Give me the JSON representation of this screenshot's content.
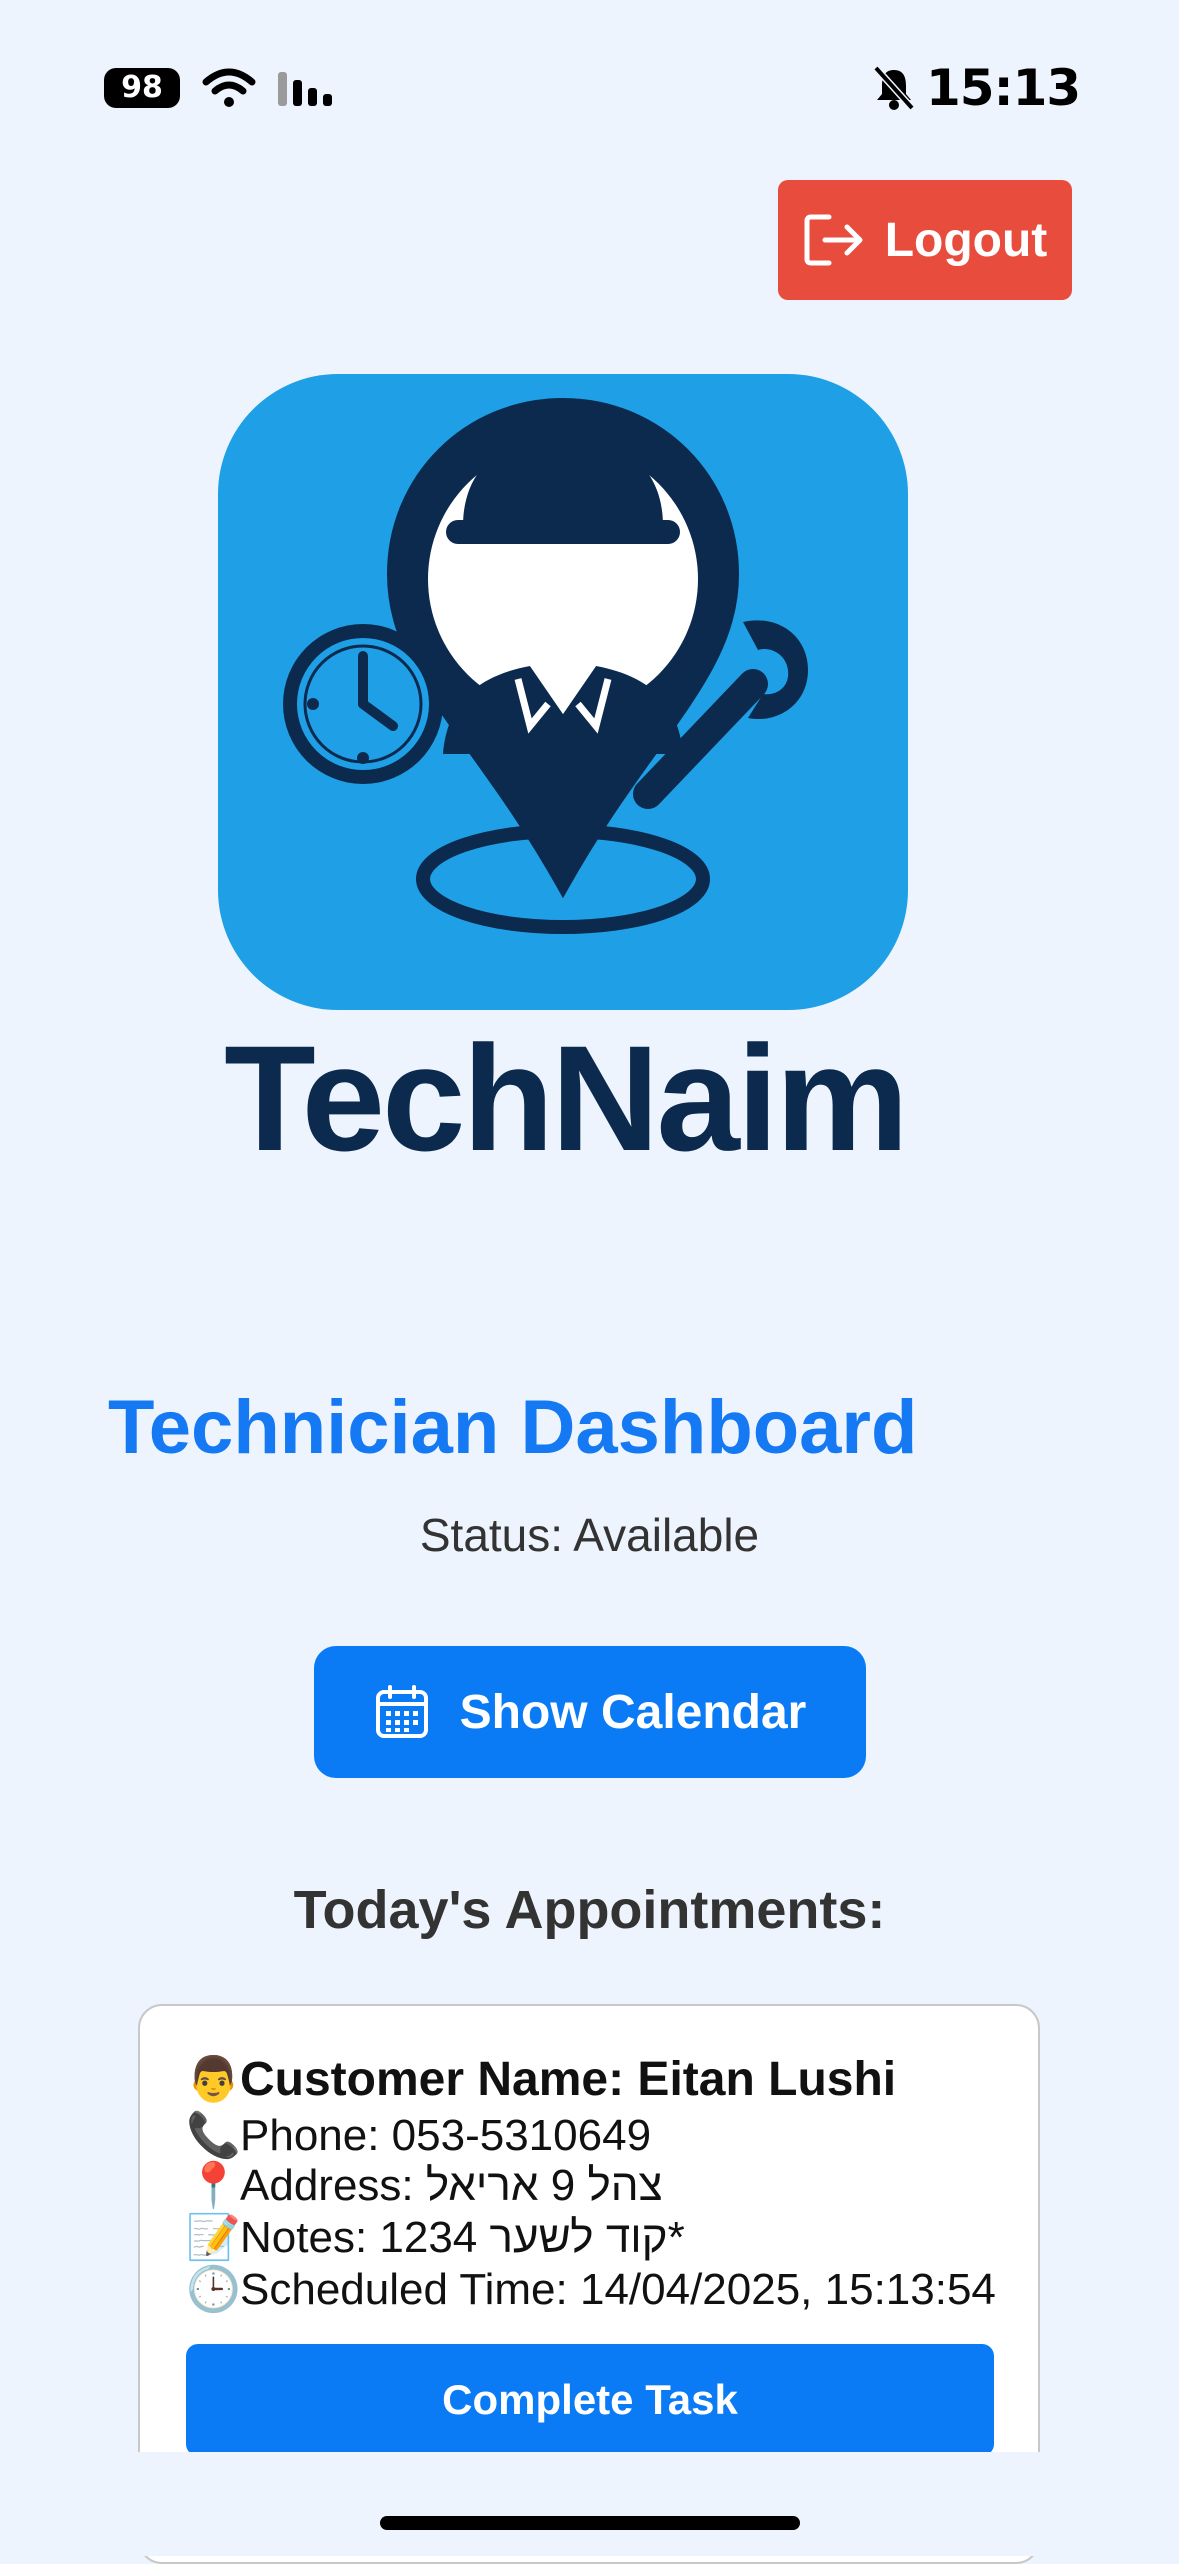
{
  "status_bar": {
    "battery": "98",
    "time": "15:13"
  },
  "header": {
    "logout_label": "Logout"
  },
  "brand": {
    "name": "TechNaim"
  },
  "dashboard": {
    "title": "Technician Dashboard",
    "status": "Status: Available",
    "calendar_button_label": "Show Calendar",
    "appointments_heading": "Today's Appointments:"
  },
  "appointment": {
    "name_line": "Customer Name: Eitan Lushi",
    "phone_line": "Phone: 053-5310649",
    "address_line": "Address: צהל 9 אריאל",
    "notes_line": "Notes: 1234 קוד לשער*",
    "time_line": "Scheduled Time: 14/04/2025, 15:13:54",
    "complete_label": "Complete Task",
    "icons": {
      "person": "👨",
      "phone": "📞",
      "pin": "📍",
      "memo": "📝",
      "clock": "🕒"
    }
  },
  "colors": {
    "background": "#eef4fd",
    "primary": "#0a7bf5",
    "logout": "#e84c3d",
    "brand_dark": "#0b2a4e",
    "logo_tile": "#1fa0e6"
  }
}
